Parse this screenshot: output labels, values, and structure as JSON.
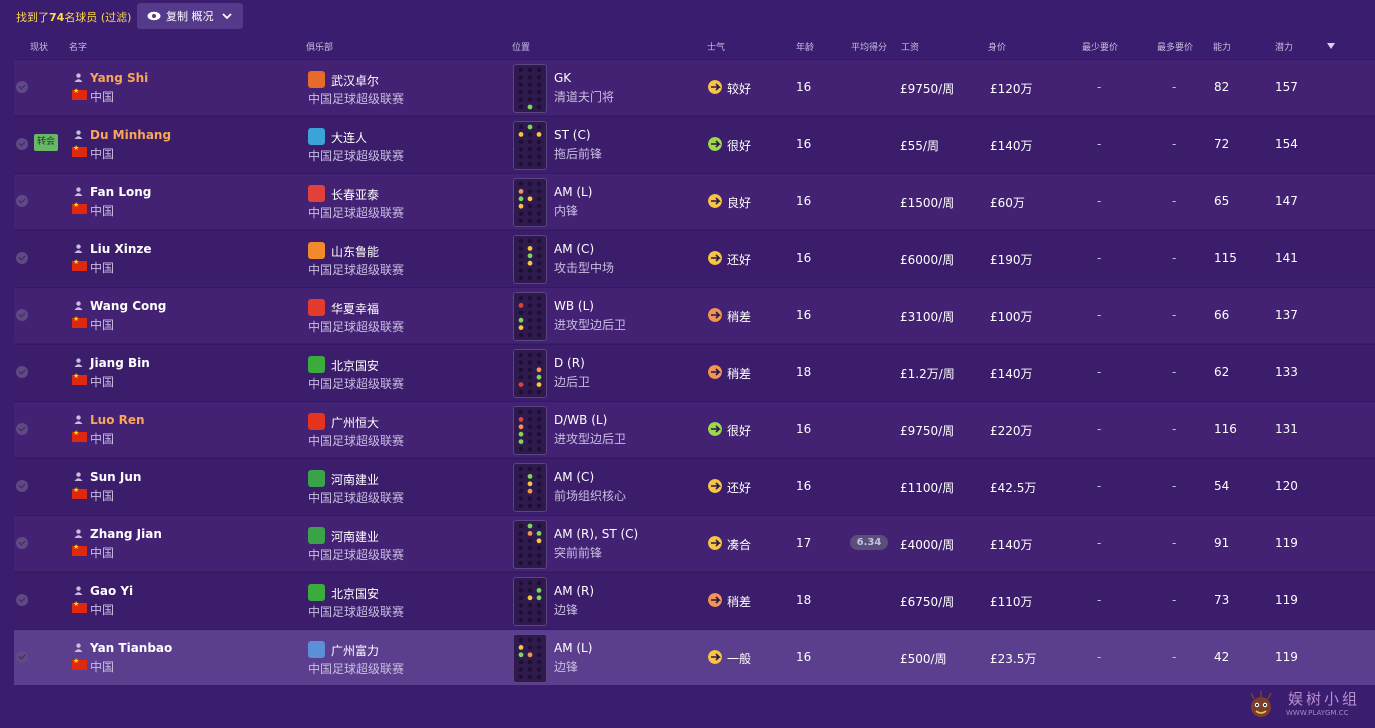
{
  "toolbar": {
    "found_prefix": "找到了",
    "found_count": "74",
    "found_suffix": "名球员",
    "filter_label": "(过滤)",
    "copy_label": "复制 概况",
    "copy_icon": "eye-icon",
    "dropdown_icon": "chevron-down-icon"
  },
  "columns": {
    "status": "现状",
    "name": "名字",
    "club": "俱乐部",
    "position": "位置",
    "morale": "士气",
    "age": "年龄",
    "avg_rating": "平均得分",
    "wage": "工资",
    "value": "身价",
    "min_fee": "最少要价",
    "max_fee": "最多要价",
    "ability": "能力",
    "potential": "潜力"
  },
  "colors": {
    "accent": "#ffd94a",
    "highlight_name": "#f7a65a",
    "background": "#3a1d6e",
    "morale_good": "#9bd84a",
    "morale_ok": "#f5c543",
    "morale_poor": "#f29553"
  },
  "players": [
    {
      "name": "Yang Shi",
      "nation": "中国",
      "club": "武汉卓尔",
      "league": "中国足球超级联赛",
      "position": "GK",
      "role": "清道夫门将",
      "morale": "较好",
      "morale_level": "ok",
      "age": "16",
      "avg": "",
      "wage": "£9750/周",
      "value": "£120万",
      "min": "-",
      "max": "-",
      "ability": "82",
      "potential": "157",
      "highlight": true,
      "badge": "",
      "club_color": "#e56a2c"
    },
    {
      "name": "Du Minhang",
      "nation": "中国",
      "club": "大连人",
      "league": "中国足球超级联赛",
      "position": "ST (C)",
      "role": "拖后前锋",
      "morale": "很好",
      "morale_level": "good",
      "age": "16",
      "avg": "",
      "wage": "£55/周",
      "value": "£140万",
      "min": "-",
      "max": "-",
      "ability": "72",
      "potential": "154",
      "highlight": true,
      "badge": "转会",
      "club_color": "#3aa4d8"
    },
    {
      "name": "Fan Long",
      "nation": "中国",
      "club": "长春亚泰",
      "league": "中国足球超级联赛",
      "position": "AM (L)",
      "role": "内锋",
      "morale": "良好",
      "morale_level": "ok",
      "age": "16",
      "avg": "",
      "wage": "£1500/周",
      "value": "£60万",
      "min": "-",
      "max": "-",
      "ability": "65",
      "potential": "147",
      "highlight": false,
      "badge": "",
      "club_color": "#e2403a"
    },
    {
      "name": "Liu Xinze",
      "nation": "中国",
      "club": "山东鲁能",
      "league": "中国足球超级联赛",
      "position": "AM (C)",
      "role": "攻击型中场",
      "morale": "还好",
      "morale_level": "ok",
      "age": "16",
      "avg": "",
      "wage": "£6000/周",
      "value": "£190万",
      "min": "-",
      "max": "-",
      "ability": "115",
      "potential": "141",
      "highlight": false,
      "badge": "",
      "club_color": "#f28a2c"
    },
    {
      "name": "Wang Cong",
      "nation": "中国",
      "club": "华夏幸福",
      "league": "中国足球超级联赛",
      "position": "WB (L)",
      "role": "进攻型边后卫",
      "morale": "稍差",
      "morale_level": "poor",
      "age": "16",
      "avg": "",
      "wage": "£3100/周",
      "value": "£100万",
      "min": "-",
      "max": "-",
      "ability": "66",
      "potential": "137",
      "highlight": false,
      "badge": "",
      "club_color": "#e53b2f"
    },
    {
      "name": "Jiang Bin",
      "nation": "中国",
      "club": "北京国安",
      "league": "中国足球超级联赛",
      "position": "D (R)",
      "role": "边后卫",
      "morale": "稍差",
      "morale_level": "poor",
      "age": "18",
      "avg": "",
      "wage": "£1.2万/周",
      "value": "£140万",
      "min": "-",
      "max": "-",
      "ability": "62",
      "potential": "133",
      "highlight": false,
      "badge": "",
      "club_color": "#3bab3e"
    },
    {
      "name": "Luo Ren",
      "nation": "中国",
      "club": "广州恒大",
      "league": "中国足球超级联赛",
      "position": "D/WB (L)",
      "role": "进攻型边后卫",
      "morale": "很好",
      "morale_level": "good",
      "age": "16",
      "avg": "",
      "wage": "£9750/周",
      "value": "£220万",
      "min": "-",
      "max": "-",
      "ability": "116",
      "potential": "131",
      "highlight": true,
      "badge": "",
      "club_color": "#e5331e"
    },
    {
      "name": "Sun Jun",
      "nation": "中国",
      "club": "河南建业",
      "league": "中国足球超级联赛",
      "position": "AM (C)",
      "role": "前场组织核心",
      "morale": "还好",
      "morale_level": "ok",
      "age": "16",
      "avg": "",
      "wage": "£1100/周",
      "value": "£42.5万",
      "min": "-",
      "max": "-",
      "ability": "54",
      "potential": "120",
      "highlight": false,
      "badge": "",
      "club_color": "#3aa34a"
    },
    {
      "name": "Zhang Jian",
      "nation": "中国",
      "club": "河南建业",
      "league": "中国足球超级联赛",
      "position": "AM (R), ST (C)",
      "role": "突前前锋",
      "morale": "凑合",
      "morale_level": "ok",
      "age": "17",
      "avg": "6.34",
      "wage": "£4000/周",
      "value": "£140万",
      "min": "-",
      "max": "-",
      "ability": "91",
      "potential": "119",
      "highlight": false,
      "badge": "",
      "club_color": "#3aa34a"
    },
    {
      "name": "Gao Yi",
      "nation": "中国",
      "club": "北京国安",
      "league": "中国足球超级联赛",
      "position": "AM (R)",
      "role": "边锋",
      "morale": "稍差",
      "morale_level": "poor",
      "age": "18",
      "avg": "",
      "wage": "£6750/周",
      "value": "£110万",
      "min": "-",
      "max": "-",
      "ability": "73",
      "potential": "119",
      "highlight": false,
      "badge": "",
      "club_color": "#3bab3e"
    },
    {
      "name": "Yan Tianbao",
      "nation": "中国",
      "club": "广州富力",
      "league": "中国足球超级联赛",
      "position": "AM (L)",
      "role": "边锋",
      "morale": "一般",
      "morale_level": "ok",
      "age": "16",
      "avg": "",
      "wage": "£500/周",
      "value": "£23.5万",
      "min": "-",
      "max": "-",
      "ability": "42",
      "potential": "119",
      "highlight": false,
      "badge": "",
      "club_color": "#5b8fd6"
    }
  ],
  "watermark": {
    "cn": "娱树小组",
    "url": "WWW.PLAYGM.CC"
  }
}
